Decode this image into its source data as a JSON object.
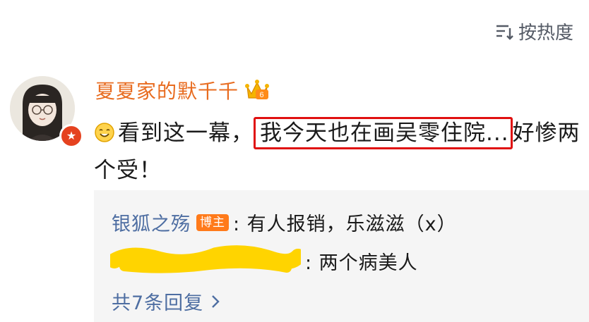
{
  "sort": {
    "label": "按热度",
    "icon": "sort-icon"
  },
  "comment": {
    "username": "夏夏家的默千千",
    "user_badge_icon": "crown-fan-icon",
    "avatar_badge_icon": "verified-star-icon",
    "emoji_icon": "smiley-emoji-icon",
    "text_before": "看到这一幕，",
    "text_highlight": "我今天也在画吴零住院...",
    "text_after": "好惨两个受！"
  },
  "replies": [
    {
      "name": "银狐之殇",
      "tag": "博主",
      "text": ": 有人报销，乐滋滋（x）"
    },
    {
      "name": "",
      "redacted": true,
      "text": ": 两个病美人"
    }
  ],
  "more_replies": {
    "label": "共7条回复",
    "icon": "chevron-right-icon"
  },
  "colors": {
    "username": "#e86b1f",
    "link": "#4e6ea2",
    "highlight_border": "#e01010",
    "scribble": "#ffd400"
  }
}
